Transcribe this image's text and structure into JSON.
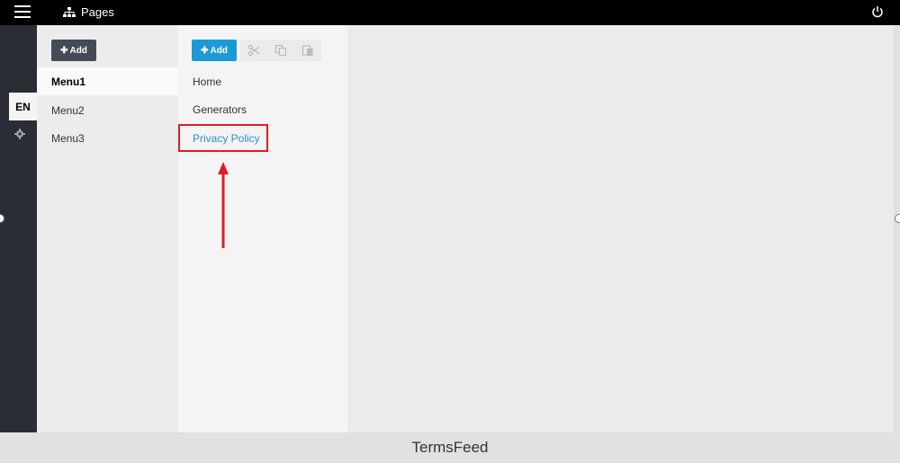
{
  "topbar": {
    "title": "Pages",
    "icons": {
      "menu": "hamburger-icon",
      "pages": "sitemap-icon",
      "power": "power-icon"
    }
  },
  "leftrail": {
    "language": "EN",
    "settings_icon": "gear-icon"
  },
  "menus": {
    "add_label": "Add",
    "items": [
      {
        "label": "Menu1",
        "active": true
      },
      {
        "label": "Menu2",
        "active": false
      },
      {
        "label": "Menu3",
        "active": false
      }
    ]
  },
  "pages": {
    "add_label": "Add",
    "toolbar_icons": [
      "cut-icon",
      "copy-icon",
      "paste-icon"
    ],
    "items": [
      {
        "label": "Home"
      },
      {
        "label": "Generators"
      },
      {
        "label": "Privacy Policy",
        "highlighted": true
      }
    ]
  },
  "annotation": {
    "color": "#e31b23"
  },
  "footer": {
    "watermark": "TermsFeed"
  },
  "colors": {
    "topbar": "#000000",
    "rail": "#2a2d35",
    "add_primary": "#1d9ad6",
    "add_dark": "#464a55",
    "link": "#2a8fc7"
  }
}
